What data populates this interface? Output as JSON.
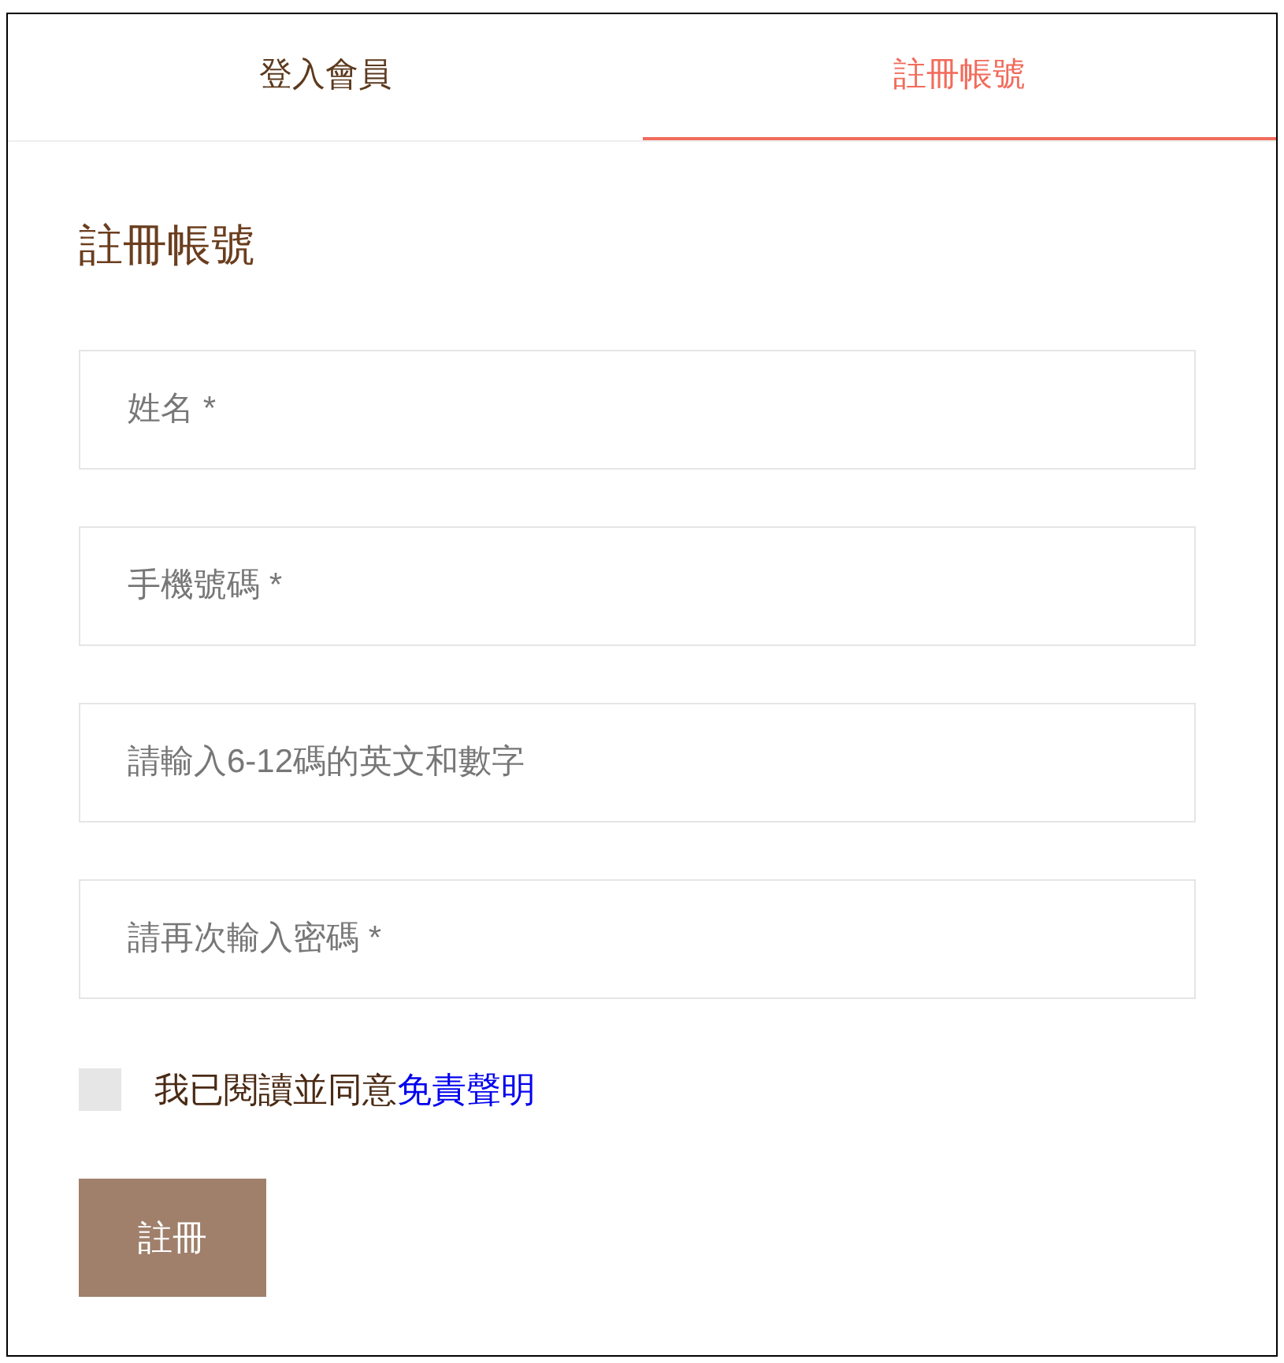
{
  "tabs": [
    {
      "label": "登入會員",
      "selected": false
    },
    {
      "label": "註冊帳號",
      "selected": true
    }
  ],
  "heading": "註冊帳號",
  "fields": [
    {
      "placeholder": "姓名 *"
    },
    {
      "placeholder": "手機號碼 *"
    },
    {
      "placeholder": "請輸入6-12碼的英文和數字"
    },
    {
      "placeholder": "請再次輸入密碼 *"
    }
  ],
  "agreement": {
    "checked": false,
    "text": "我已閱讀並同意",
    "link": "免責聲明"
  },
  "submit": "註冊"
}
